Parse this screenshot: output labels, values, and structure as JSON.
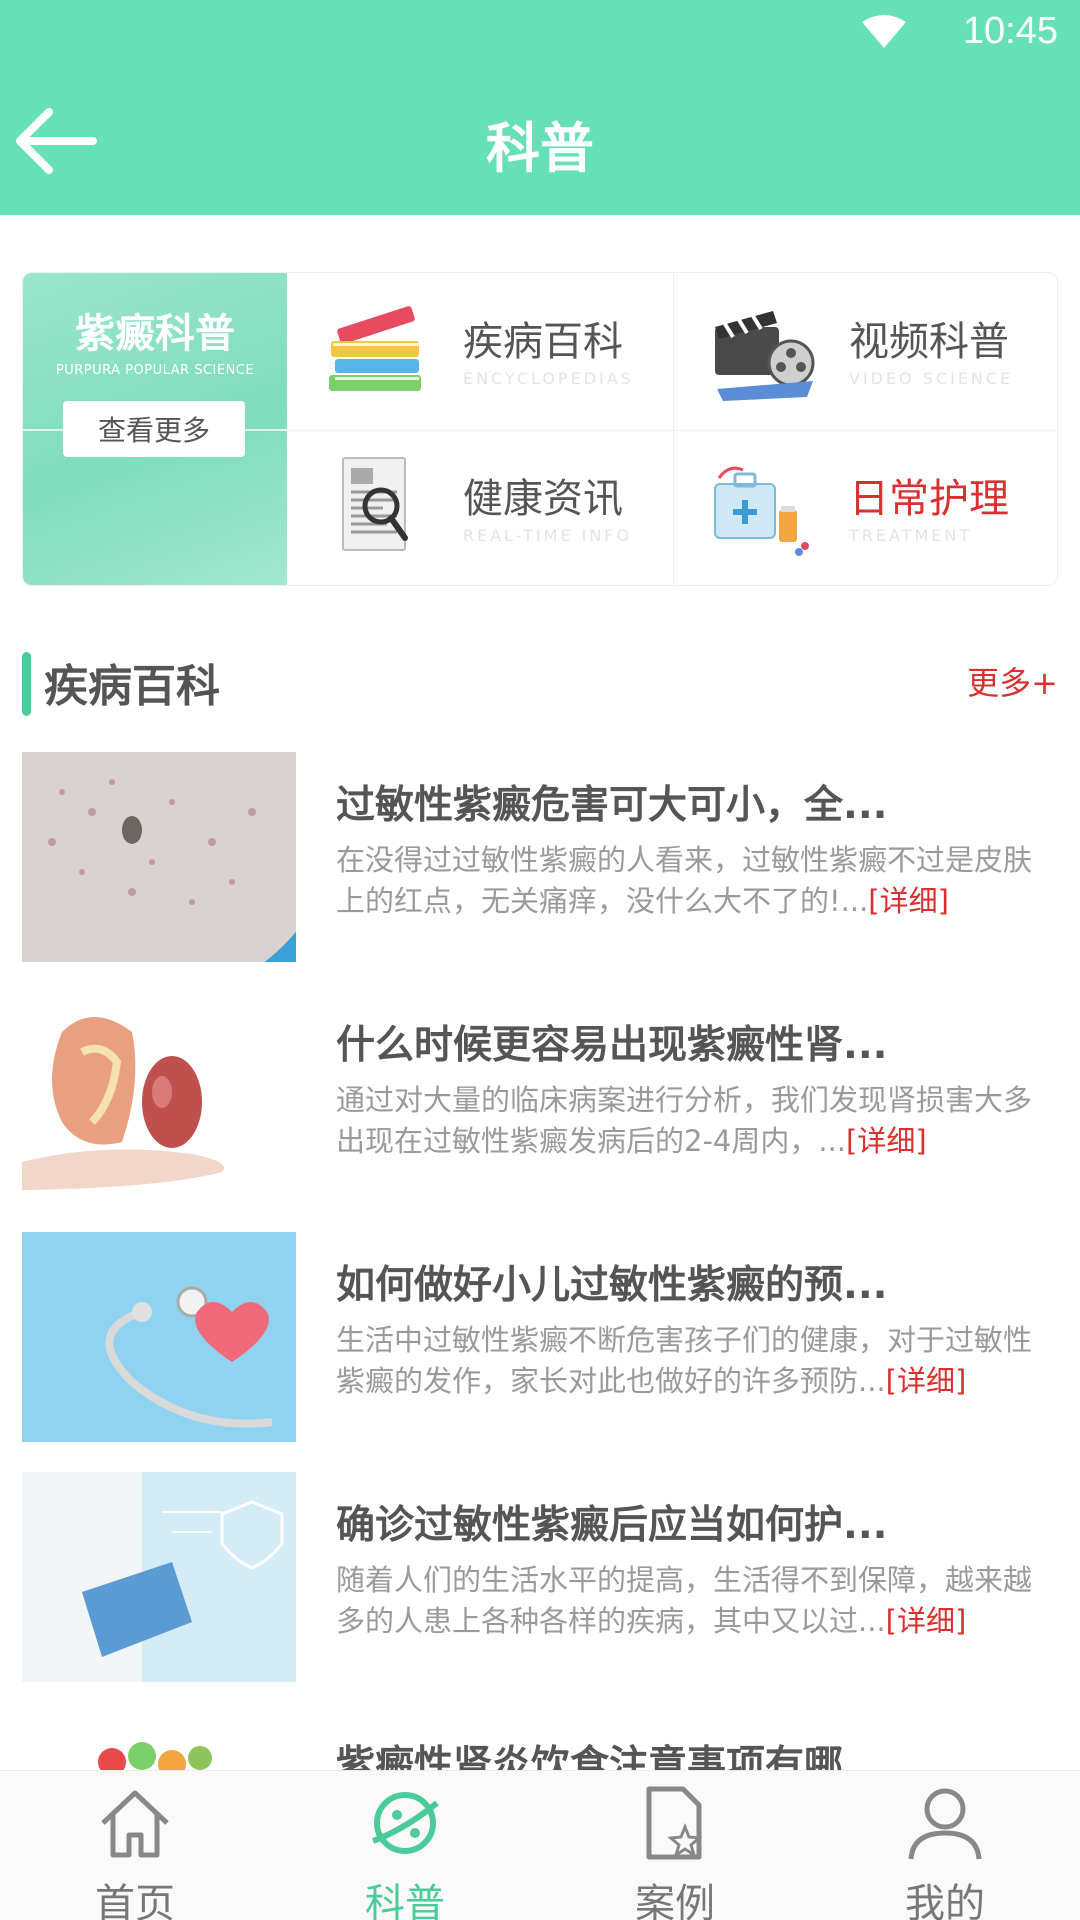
{
  "status_bar": {
    "time": "10:45"
  },
  "header": {
    "title": "科普"
  },
  "promo": {
    "title": "紫癜科普",
    "subtitle": "PURPURA POPULAR SCIENCE",
    "button_label": "查看更多"
  },
  "categories": [
    {
      "label": "疾病百科",
      "en": "ENCYCLOPEDIAS",
      "icon": "books-icon",
      "color": "#555555"
    },
    {
      "label": "视频科普",
      "en": "VIDEO SCIENCE",
      "icon": "film-clapper-icon",
      "color": "#555555"
    },
    {
      "label": "健康资讯",
      "en": "REAL-TIME INFO",
      "icon": "newspaper-magnifier-icon",
      "color": "#555555"
    },
    {
      "label": "日常护理",
      "en": "TREATMENT",
      "icon": "first-aid-kit-icon",
      "color": "#d93030"
    }
  ],
  "section": {
    "title": "疾病百科",
    "more": "更多+"
  },
  "articles": [
    {
      "title": "过敏性紫癜危害可大可小，全...",
      "desc": "在没得过过敏性紫癜的人看来，过敏性紫癜不过是皮肤上的红点，无关痛痒，没什么大不了的!...",
      "more": "[详细]"
    },
    {
      "title": "什么时候更容易出现紫癜性肾...",
      "desc": "通过对大量的临床病案进行分析，我们发现肾损害大多出现在过敏性紫癜发病后的2-4周内，...",
      "more": "[详细]"
    },
    {
      "title": "如何做好小儿过敏性紫癜的预...",
      "desc": "生活中过敏性紫癜不断危害孩子们的健康，对于过敏性紫癜的发作，家长对此也做好的许多预防...",
      "more": "[详细]"
    },
    {
      "title": "确诊过敏性紫癜后应当如何护...",
      "desc": "随着人们的生活水平的提高，生活得不到保障，越来越多的人患上各种各样的疾病，其中又以过...",
      "more": "[详细]"
    },
    {
      "title": "紫癜性肾炎饮食注意事项有哪...",
      "desc": "",
      "more": ""
    }
  ],
  "nav": [
    {
      "label": "首页",
      "icon": "home-icon",
      "active": false
    },
    {
      "label": "科普",
      "icon": "science-planet-icon",
      "active": true
    },
    {
      "label": "案例",
      "icon": "document-star-icon",
      "active": false
    },
    {
      "label": "我的",
      "icon": "user-icon",
      "active": false
    }
  ],
  "colors": {
    "header": "#66e0b6",
    "accent": "#4ccb9a",
    "link": "#d93030"
  }
}
